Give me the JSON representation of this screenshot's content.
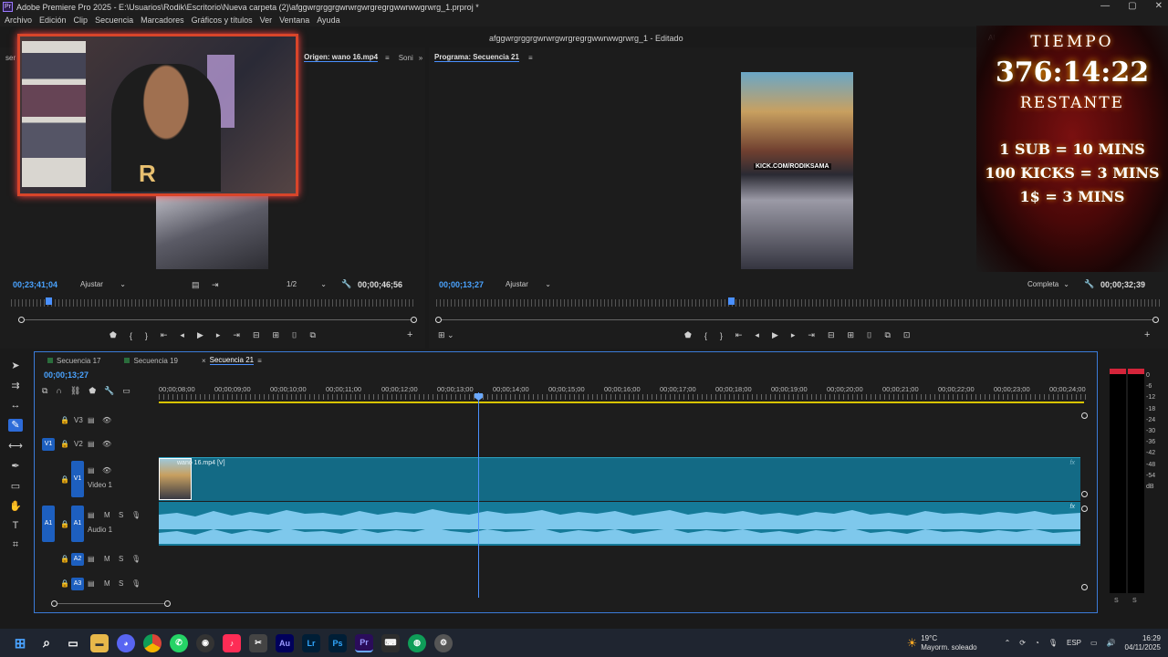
{
  "window": {
    "title": "Adobe Premiere Pro 2025 - E:\\Usuarios\\Rodik\\Escritorio\\Nueva carpeta (2)\\afggwrgrggrgwrwrgwrgregrgwwrwwgrwrg_1.prproj *",
    "app_badge": "Pr",
    "workspace_title": "afggwrgrggrgwrwrgwrgregrgwwrwwgrwrg_1 - Editado",
    "al_label": "Al"
  },
  "menu": [
    "Archivo",
    "Edición",
    "Clip",
    "Secuencia",
    "Marcadores",
    "Gráficos y títulos",
    "Ver",
    "Ventana",
    "Ayuda"
  ],
  "source_monitor": {
    "left_cut": "ser",
    "tab_active": "Origen: wano 16.mp4",
    "tab_next": "Soni",
    "timecode_current": "00;23;41;04",
    "fit_label": "Ajustar",
    "resolution": "1/2",
    "timecode_duration": "00;00;46;56"
  },
  "program_monitor": {
    "tab_active": "Programa: Secuencia 21",
    "timecode_current": "00;00;13;27",
    "fit_label": "Ajustar",
    "resolution": "Completa",
    "timecode_duration": "00;00;32;39",
    "overlay_text": "KICK.COM/RODIKSAMA"
  },
  "timer_overlay": {
    "label": "TIEMPO",
    "value": "376:14:22",
    "sublabel": "RESTANTE",
    "rules": [
      "1 SUB = 10 MINS",
      "100 KICKS = 3 MINS",
      "1$ = 3 MINS"
    ]
  },
  "timeline": {
    "tabs": [
      "Secuencia 17",
      "Secuencia 19",
      "Secuencia 21"
    ],
    "active_tab": "Secuencia 21",
    "timecode": "00;00;13;27",
    "ruler": [
      "00;00;08;00",
      "00;00;09;00",
      "00;00;10;00",
      "00;00;11;00",
      "00;00;12;00",
      "00;00;13;00",
      "00;00;14;00",
      "00;00;15;00",
      "00;00;16;00",
      "00;00;17;00",
      "00;00;18;00",
      "00;00;19;00",
      "00;00;20;00",
      "00;00;21;00",
      "00;00;22;00",
      "00;00;23;00",
      "00;00;24;00"
    ],
    "tracks": {
      "v3": "V3",
      "v2": "V2",
      "v1": "V1",
      "v1_src": "V1",
      "video1_name": "Video 1",
      "a1": "A1",
      "a1_src": "A1",
      "audio1_name": "Audio 1",
      "a2": "A2",
      "a3": "A3",
      "m": "M",
      "s": "S"
    },
    "video_clip_label": "wano 16.mp4 [V]",
    "fx_label": "fx"
  },
  "meters": {
    "scale": [
      "0",
      "-6",
      "-12",
      "-18",
      "-24",
      "-30",
      "-36",
      "-42",
      "-48",
      "-54",
      "dB"
    ],
    "solo": [
      "S",
      "S"
    ]
  },
  "taskbar": {
    "weather_temp": "19°C",
    "weather_desc": "Mayorm. soleado",
    "lang": "ESP",
    "time": "16:29",
    "date": "04/11/2025",
    "apps": [
      "Au",
      "Lr",
      "Ps",
      "Pr"
    ]
  }
}
